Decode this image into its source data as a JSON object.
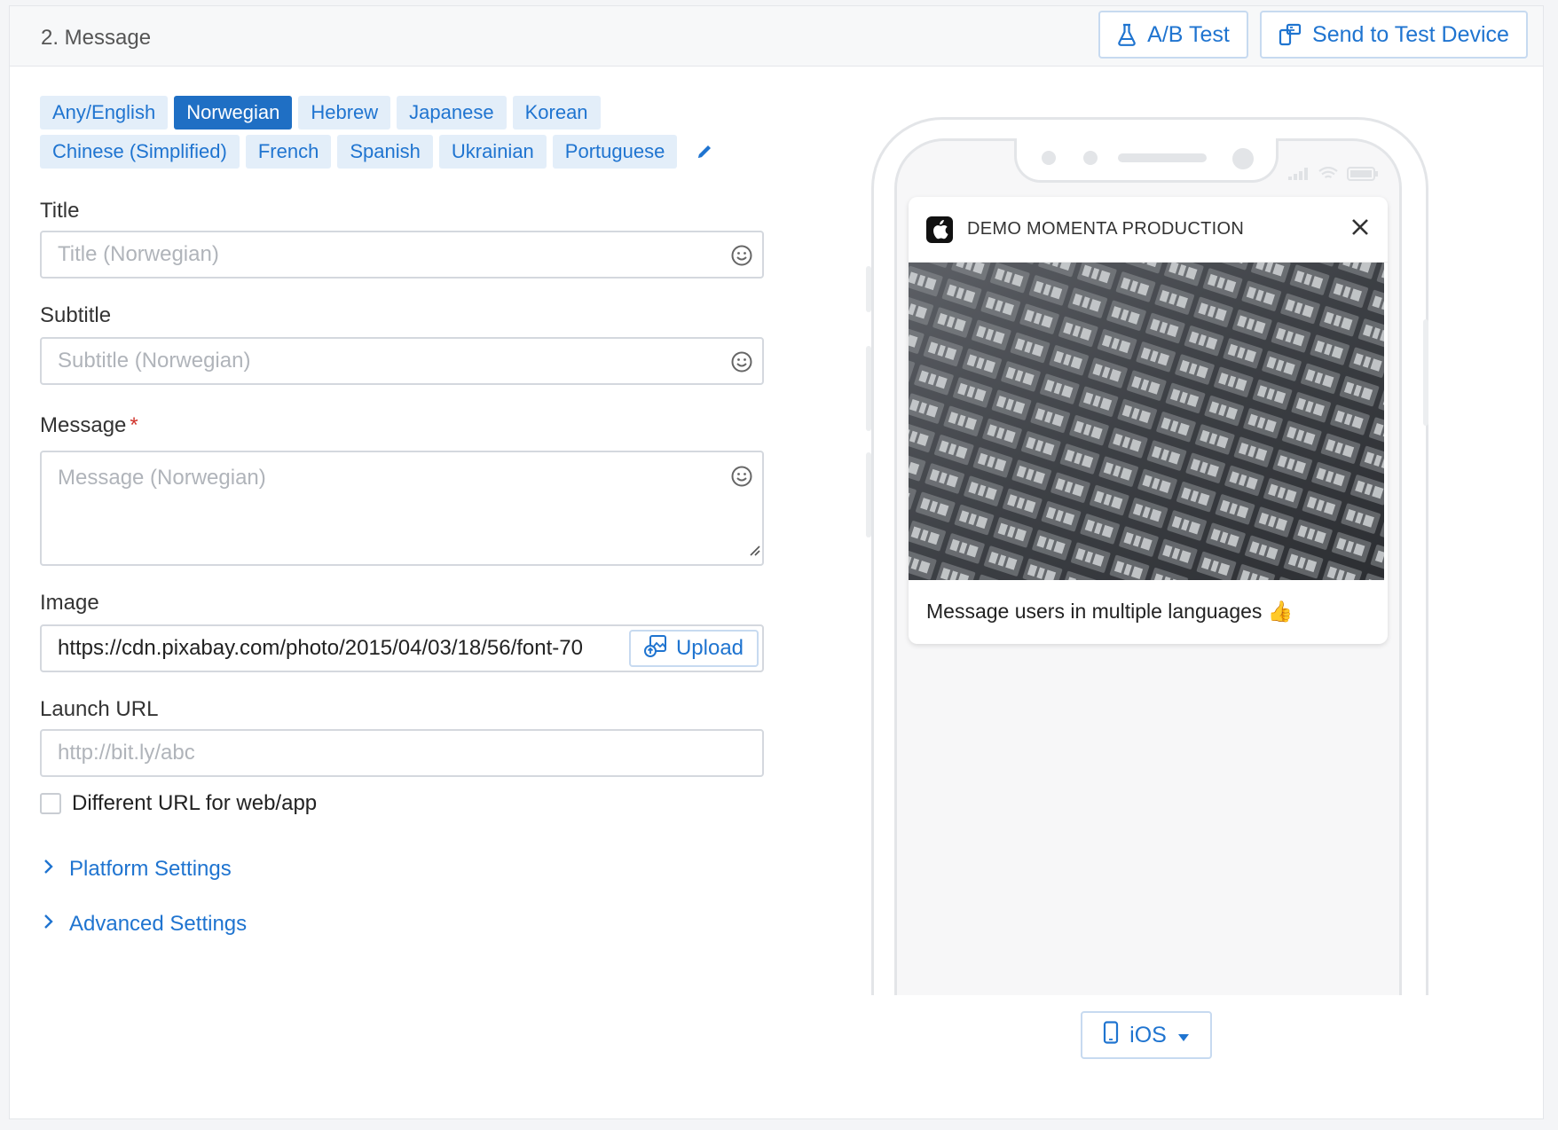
{
  "header": {
    "title": "2. Message",
    "ab_test_label": "A/B Test",
    "send_test_label": "Send to Test Device"
  },
  "languages": {
    "row1": [
      "Any/English",
      "Norwegian",
      "Hebrew",
      "Japanese",
      "Korean"
    ],
    "row2": [
      "Chinese (Simplified)",
      "French",
      "Spanish",
      "Ukrainian",
      "Portuguese"
    ],
    "active": "Norwegian"
  },
  "form": {
    "title_label": "Title",
    "title_placeholder": "Title (Norwegian)",
    "subtitle_label": "Subtitle",
    "subtitle_placeholder": "Subtitle (Norwegian)",
    "message_label": "Message",
    "message_required_mark": "*",
    "message_placeholder": "Message (Norwegian)",
    "image_label": "Image",
    "image_value": "https://cdn.pixabay.com/photo/2015/04/03/18/56/font-70",
    "upload_label": "Upload",
    "launch_url_label": "Launch URL",
    "launch_url_placeholder": "http://bit.ly/abc",
    "different_url_label": "Different URL for web/app",
    "platform_settings_label": "Platform Settings",
    "advanced_settings_label": "Advanced Settings"
  },
  "preview": {
    "app_name": "DEMO MOMENTA PRODUCTION",
    "message": "Message users in multiple languages 👍",
    "platform_label": "iOS"
  },
  "colors": {
    "accent": "#1f74d0",
    "active_chip": "#1f6fc4",
    "chip_bg": "#e3eef9",
    "required": "#d0342c"
  }
}
